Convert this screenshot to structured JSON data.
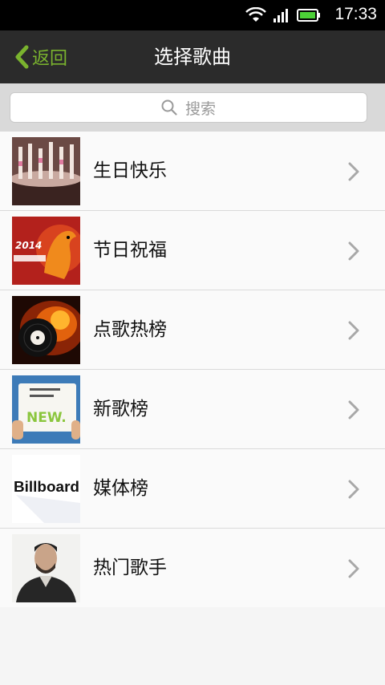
{
  "status": {
    "time": "17:33"
  },
  "header": {
    "back_label": "返回",
    "title": "选择歌曲"
  },
  "search": {
    "placeholder": "搜索"
  },
  "items": [
    {
      "label": "生日快乐"
    },
    {
      "label": "节日祝福",
      "thumb_text": "2014"
    },
    {
      "label": "点歌热榜"
    },
    {
      "label": "新歌榜",
      "thumb_text": "NEW."
    },
    {
      "label": "媒体榜",
      "thumb_text": "Billboard"
    },
    {
      "label": "热门歌手"
    }
  ],
  "colors": {
    "accent": "#7ab32e",
    "navbar": "#2b2b2b",
    "statusbar": "#000000",
    "battery": "#4cd137"
  }
}
